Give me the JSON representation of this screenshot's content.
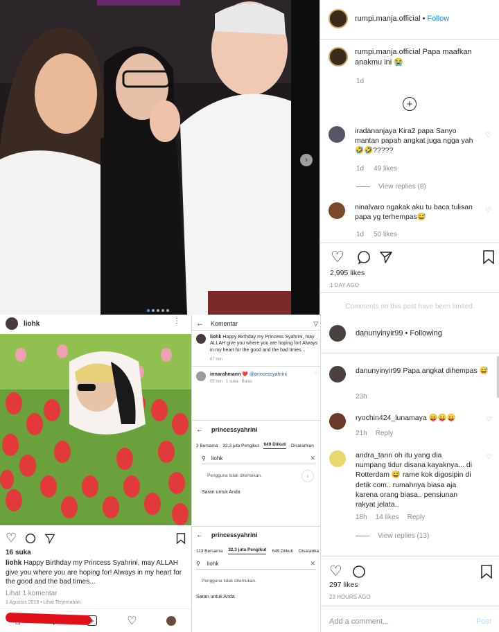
{
  "post1": {
    "username": "rumpi.manja.official",
    "follow": "Follow",
    "caption": "Papa maafkan anakmu ini 😭",
    "caption_time": "1d",
    "comments": [
      {
        "user": "iradananjaya",
        "text": "Kira2 papa Sanyo mantan papah angkat juga ngga yah🤣🤣?????",
        "time": "1d",
        "likes": "49 likes",
        "view_replies": "View replies (8)"
      },
      {
        "user": "ninalvaro",
        "text": "ngakak aku tu baca tulisan papa yg terhempas😅",
        "time": "1d",
        "likes": "50 likes"
      }
    ],
    "likes": "2,995 likes",
    "date": "1 DAY AGO",
    "limited": "Comments on this post have been limited."
  },
  "post2": {
    "username": "liohk",
    "likes": "16 suka",
    "caption_user": "liohk",
    "caption": "Happy Birthday my Princess Syahrini, may ALLAH give you where you are hoping for! Always in my heart for the good and the bad times...",
    "see_comments": "Lihat 1 komentar",
    "date": "1 Agustus 2018 • Lihat Terjemahan"
  },
  "komentar": {
    "header": "Komentar",
    "c1_user": "liohk",
    "c1_text": "Happy Birthday my Princess Syahrini, may ALLAH give you where you are hoping for! Always in my heart for the good and the bad times...",
    "c1_time": "67 min",
    "c2_user": "irmarahmann",
    "c2_text": "❤️ @princessyahrini",
    "c2_meta": "55 min   1 suka   Balas"
  },
  "search1": {
    "username": "princessyahrini",
    "tabs": [
      "3 Bersama",
      "32,3 juta Pengikut",
      "649 Diikuti",
      "Disarankan"
    ],
    "query": "liohk",
    "no_result": "Pengguna tidak ditemukan.",
    "suggest": "Saran untuk Anda"
  },
  "search2": {
    "username": "princessyahrini",
    "tabs": [
      "113 Bersama",
      "32,3 juta Pengikut",
      "649 Diikuti",
      "Disaranka"
    ],
    "query": "liohk",
    "no_result": "Pengguna tidak ditemukan.",
    "suggest": "Saran untuk Anda"
  },
  "post3": {
    "username": "danunyinyir99",
    "following": "Following",
    "caption": "Papa angkat dihempas 😅",
    "caption_time": "23h",
    "comments": [
      {
        "user": "ryochin424_lunamaya",
        "text": "😛😛😛",
        "time": "21h",
        "reply": "Reply"
      },
      {
        "user": "andra_tann",
        "text": "oh itu yang dia numpang tidur disana kayaknya... di Rotterdam 😅 rame kok digosipin di detik com.. rumahnya biasa aja karena orang biasa.. pensiunan rakyat jelata..",
        "time": "18h",
        "likes": "14 likes",
        "reply": "Reply",
        "view_replies": "View replies (13)"
      }
    ],
    "likes": "297 likes",
    "date": "23 HOURS AGO",
    "add_comment": "Add a comment...",
    "post": "Post"
  }
}
